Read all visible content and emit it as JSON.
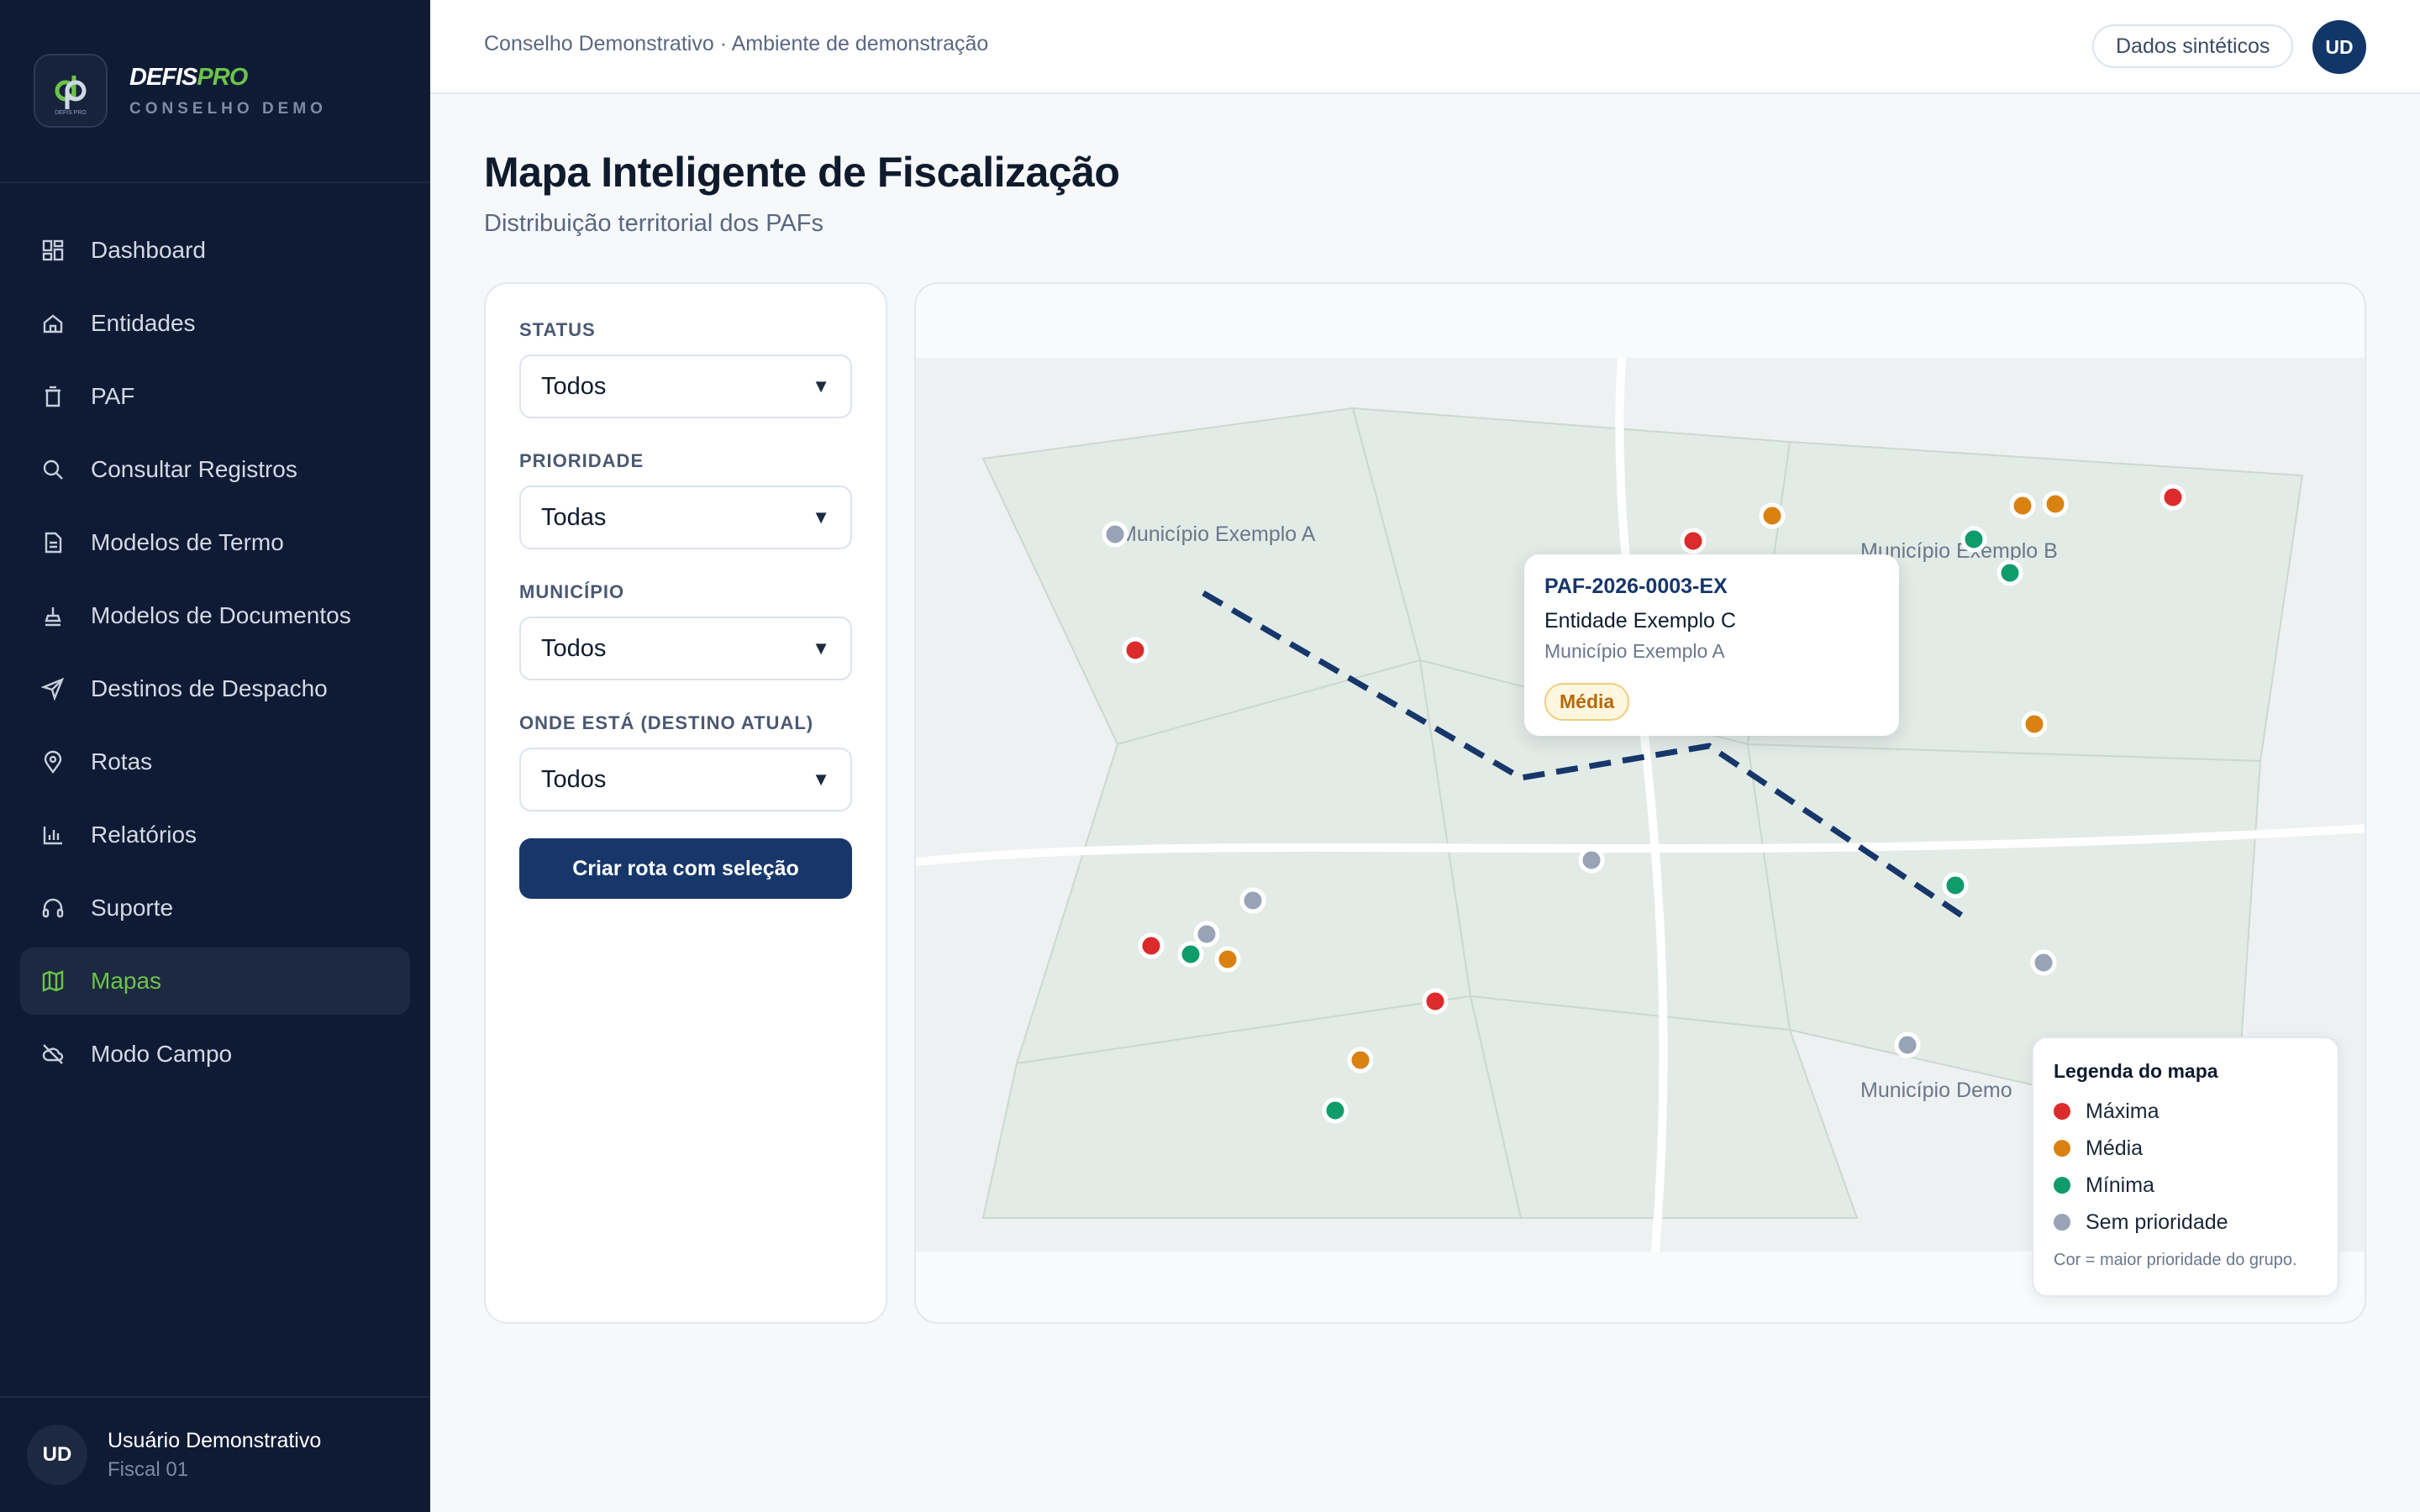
{
  "brand": {
    "name_part1": "DEFIS",
    "name_part2": "PRO",
    "subtitle": "CONSELHO DEMO",
    "logo_text": "DEFIS PRO"
  },
  "sidebar": {
    "items": [
      {
        "label": "Dashboard",
        "icon": "dashboard-grid-icon"
      },
      {
        "label": "Entidades",
        "icon": "building-icon"
      },
      {
        "label": "PAF",
        "icon": "trash-icon"
      },
      {
        "label": "Consultar Registros",
        "icon": "search-icon"
      },
      {
        "label": "Modelos de Termo",
        "icon": "document-icon"
      },
      {
        "label": "Modelos de Documentos",
        "icon": "stamp-icon"
      },
      {
        "label": "Destinos de Despacho",
        "icon": "send-icon"
      },
      {
        "label": "Rotas",
        "icon": "map-pin-icon"
      },
      {
        "label": "Relatórios",
        "icon": "bar-chart-icon"
      },
      {
        "label": "Suporte",
        "icon": "headset-icon"
      },
      {
        "label": "Mapas",
        "icon": "map-icon",
        "active": true
      },
      {
        "label": "Modo Campo",
        "icon": "cloud-off-icon"
      }
    ]
  },
  "user": {
    "initials": "UD",
    "name": "Usuário Demonstrativo",
    "role": "Fiscal 01"
  },
  "topbar": {
    "breadcrumb": "Conselho Demonstrativo · Ambiente de demonstração",
    "badge": "Dados sintéticos",
    "avatar": "UD"
  },
  "header": {
    "title": "Mapa Inteligente de Fiscalização",
    "subtitle": "Distribuição territorial dos PAFs"
  },
  "filters": {
    "status": {
      "label": "STATUS",
      "value": "Todos"
    },
    "priority": {
      "label": "PRIORIDADE",
      "value": "Todas"
    },
    "municipality": {
      "label": "MUNICÍPIO",
      "value": "Todos"
    },
    "destination": {
      "label": "ONDE ESTÁ (DESTINO ATUAL)",
      "value": "Todos"
    },
    "button": "Criar rota com seleção"
  },
  "map": {
    "region_labels": [
      "Município Exemplo A",
      "Município Exemplo B",
      "Município Demo"
    ],
    "tooltip": {
      "id": "PAF-2026-0003-EX",
      "entity": "Entidade Exemplo C",
      "municipality": "Município Exemplo A",
      "priority": "Média"
    },
    "legend": {
      "title": "Legenda do mapa",
      "items": [
        {
          "label": "Máxima",
          "color": "#dc2b2b"
        },
        {
          "label": "Média",
          "color": "#d98212"
        },
        {
          "label": "Mínima",
          "color": "#0f9b6a"
        },
        {
          "label": "Sem prioridade",
          "color": "#98a3b7"
        }
      ],
      "note": "Cor = maior prioridade do grupo."
    }
  }
}
